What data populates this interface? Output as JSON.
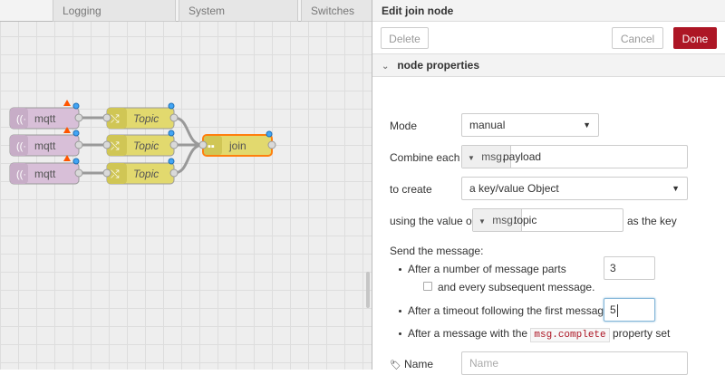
{
  "workspace": {
    "tabs": [
      "Logging",
      "System",
      "Switches"
    ],
    "nodes": {
      "mqtt": [
        "mqtt",
        "mqtt",
        "mqtt"
      ],
      "topic": [
        "Topic",
        "Topic",
        "Topic"
      ],
      "join": "join"
    }
  },
  "editor": {
    "title": "Edit join node",
    "buttons": {
      "delete": "Delete",
      "cancel": "Cancel",
      "done": "Done"
    },
    "section_title": "node properties",
    "mode": {
      "label": "Mode",
      "value": "manual"
    },
    "combine": {
      "label": "Combine each",
      "type": "msg.",
      "value": "payload"
    },
    "create": {
      "label": "to create",
      "value": "a key/value Object"
    },
    "key": {
      "label_before": "using the value of",
      "type": "msg.",
      "value": "topic",
      "label_after": "as the key"
    },
    "send": {
      "label": "Send the message:",
      "parts_label": "After a number of message parts",
      "parts_value": "3",
      "subsequent_label": "and every subsequent message.",
      "timeout_label": "After a timeout following the first message",
      "timeout_value": "5",
      "complete_before": "After a message with the",
      "complete_code": "msg.complete",
      "complete_after": "property set"
    },
    "name": {
      "label": "Name",
      "placeholder": "Name"
    }
  },
  "colors": {
    "mqtt_node": "#d8bfd8",
    "topic_node": "#e2d96e",
    "join_node": "#e2d96e",
    "done_button": "#ad1625",
    "warning": "#ff5500",
    "status_dot": "#42a5f5"
  }
}
